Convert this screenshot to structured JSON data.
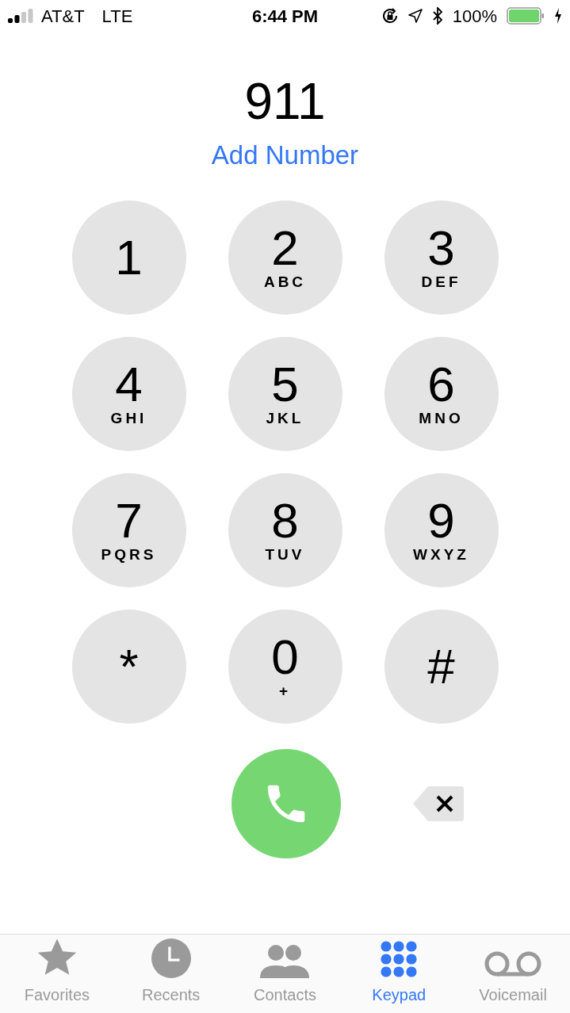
{
  "status_bar": {
    "carrier": "AT&T",
    "network": "LTE",
    "time": "6:44 PM",
    "battery_percent": "100%"
  },
  "dialed_number": "911",
  "add_number": "Add Number",
  "keys": [
    {
      "digit": "1"
    },
    {
      "digit": "2",
      "letters": "ABC"
    },
    {
      "digit": "3",
      "letters": "DEF"
    },
    {
      "digit": "4",
      "letters": "GHI"
    },
    {
      "digit": "5",
      "letters": "JKL"
    },
    {
      "digit": "6",
      "letters": "MNO"
    },
    {
      "digit": "7",
      "letters": "PQRS"
    },
    {
      "digit": "8",
      "letters": "TUV"
    },
    {
      "digit": "9",
      "letters": "WXYZ"
    },
    {
      "digit": "*"
    },
    {
      "digit": "0",
      "letters": "+"
    },
    {
      "digit": "#"
    }
  ],
  "tabs": [
    {
      "label": "Favorites",
      "kind": "star",
      "selected": false
    },
    {
      "label": "Recents",
      "kind": "clock",
      "selected": false
    },
    {
      "label": "Contacts",
      "kind": "people",
      "selected": false
    },
    {
      "label": "Keypad",
      "kind": "keypad",
      "selected": true
    },
    {
      "label": "Voicemail",
      "kind": "voicemail",
      "selected": false
    }
  ]
}
